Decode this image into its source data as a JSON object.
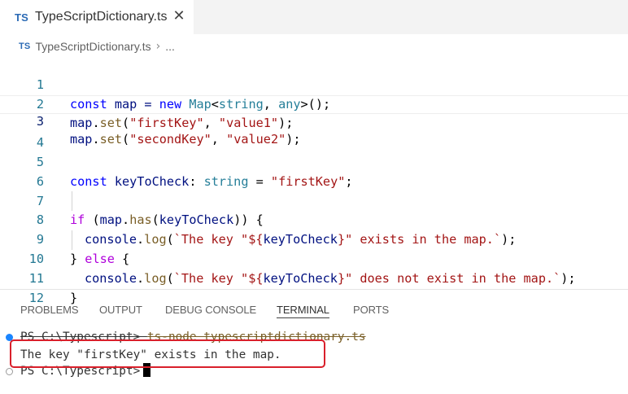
{
  "tab": {
    "badge": "TS",
    "title": "TypeScriptDictionary.ts",
    "close": "✕"
  },
  "breadcrumb": {
    "badge": "TS",
    "file": "TypeScriptDictionary.ts",
    "separator": "›",
    "more": "..."
  },
  "editor": {
    "current_line": 3,
    "lines": [
      {
        "n": "1"
      },
      {
        "n": "2"
      },
      {
        "n": "3"
      },
      {
        "n": "4"
      },
      {
        "n": "5"
      },
      {
        "n": "6"
      },
      {
        "n": "7"
      },
      {
        "n": "8"
      },
      {
        "n": "9"
      },
      {
        "n": "10"
      },
      {
        "n": "11"
      },
      {
        "n": "12"
      }
    ],
    "code": {
      "l1": {
        "t1": "const",
        "t2": " map = ",
        "t3": "new",
        "t4": " ",
        "t5": "Map",
        "t6": "<",
        "t7": "string",
        "t8": ", ",
        "t9": "any",
        "t10": ">();"
      },
      "l2": {
        "t1": "map",
        "t2": ".",
        "t3": "set",
        "t4": "(",
        "t5": "\"firstKey\"",
        "t6": ", ",
        "t7": "\"value1\"",
        "t8": ");"
      },
      "l3": {
        "t1": "map",
        "t2": ".",
        "t3": "set",
        "t4": "(",
        "t5": "\"secondKey\"",
        "t6": ", ",
        "t7": "\"value2\"",
        "t8": ");"
      },
      "l5": {
        "t1": "const",
        "t2": " ",
        "t3": "keyToCheck",
        "t4": ": ",
        "t5": "string",
        "t6": " = ",
        "t7": "\"firstKey\"",
        "t8": ";"
      },
      "l7": {
        "t1": "if",
        "t2": " (",
        "t3": "map",
        "t4": ".",
        "t5": "has",
        "t6": "(",
        "t7": "keyToCheck",
        "t8": ")) {"
      },
      "l8": {
        "t1": "console",
        "t2": ".",
        "t3": "log",
        "t4": "(",
        "t5": "`The key \"${",
        "t6": "keyToCheck",
        "t7": "}\" exists in the map.`",
        "t8": ");"
      },
      "l9": {
        "t1": "} ",
        "t2": "else",
        "t3": " {"
      },
      "l10": {
        "t1": "console",
        "t2": ".",
        "t3": "log",
        "t4": "(",
        "t5": "`The key \"${",
        "t6": "keyToCheck",
        "t7": "}\" does not exist in the map.`",
        "t8": ");"
      },
      "l11": {
        "t1": "}"
      }
    }
  },
  "panel": {
    "tabs": [
      "PROBLEMS",
      "OUTPUT",
      "DEBUG CONSOLE",
      "TERMINAL",
      "PORTS"
    ],
    "active_tab": "TERMINAL"
  },
  "terminal": {
    "prompt1": "PS C:\\Typescript> ",
    "command": "ts-node typescriptdictionary.ts",
    "output": "The key \"firstKey\" exists in the map.",
    "prompt2": "PS C:\\Typescript>"
  },
  "colors": {
    "keyword": "#0000ff",
    "control": "#af00db",
    "variable": "#001080",
    "function": "#795e26",
    "string": "#a31515",
    "type": "#267f99",
    "highlight_box": "#d9202b"
  }
}
